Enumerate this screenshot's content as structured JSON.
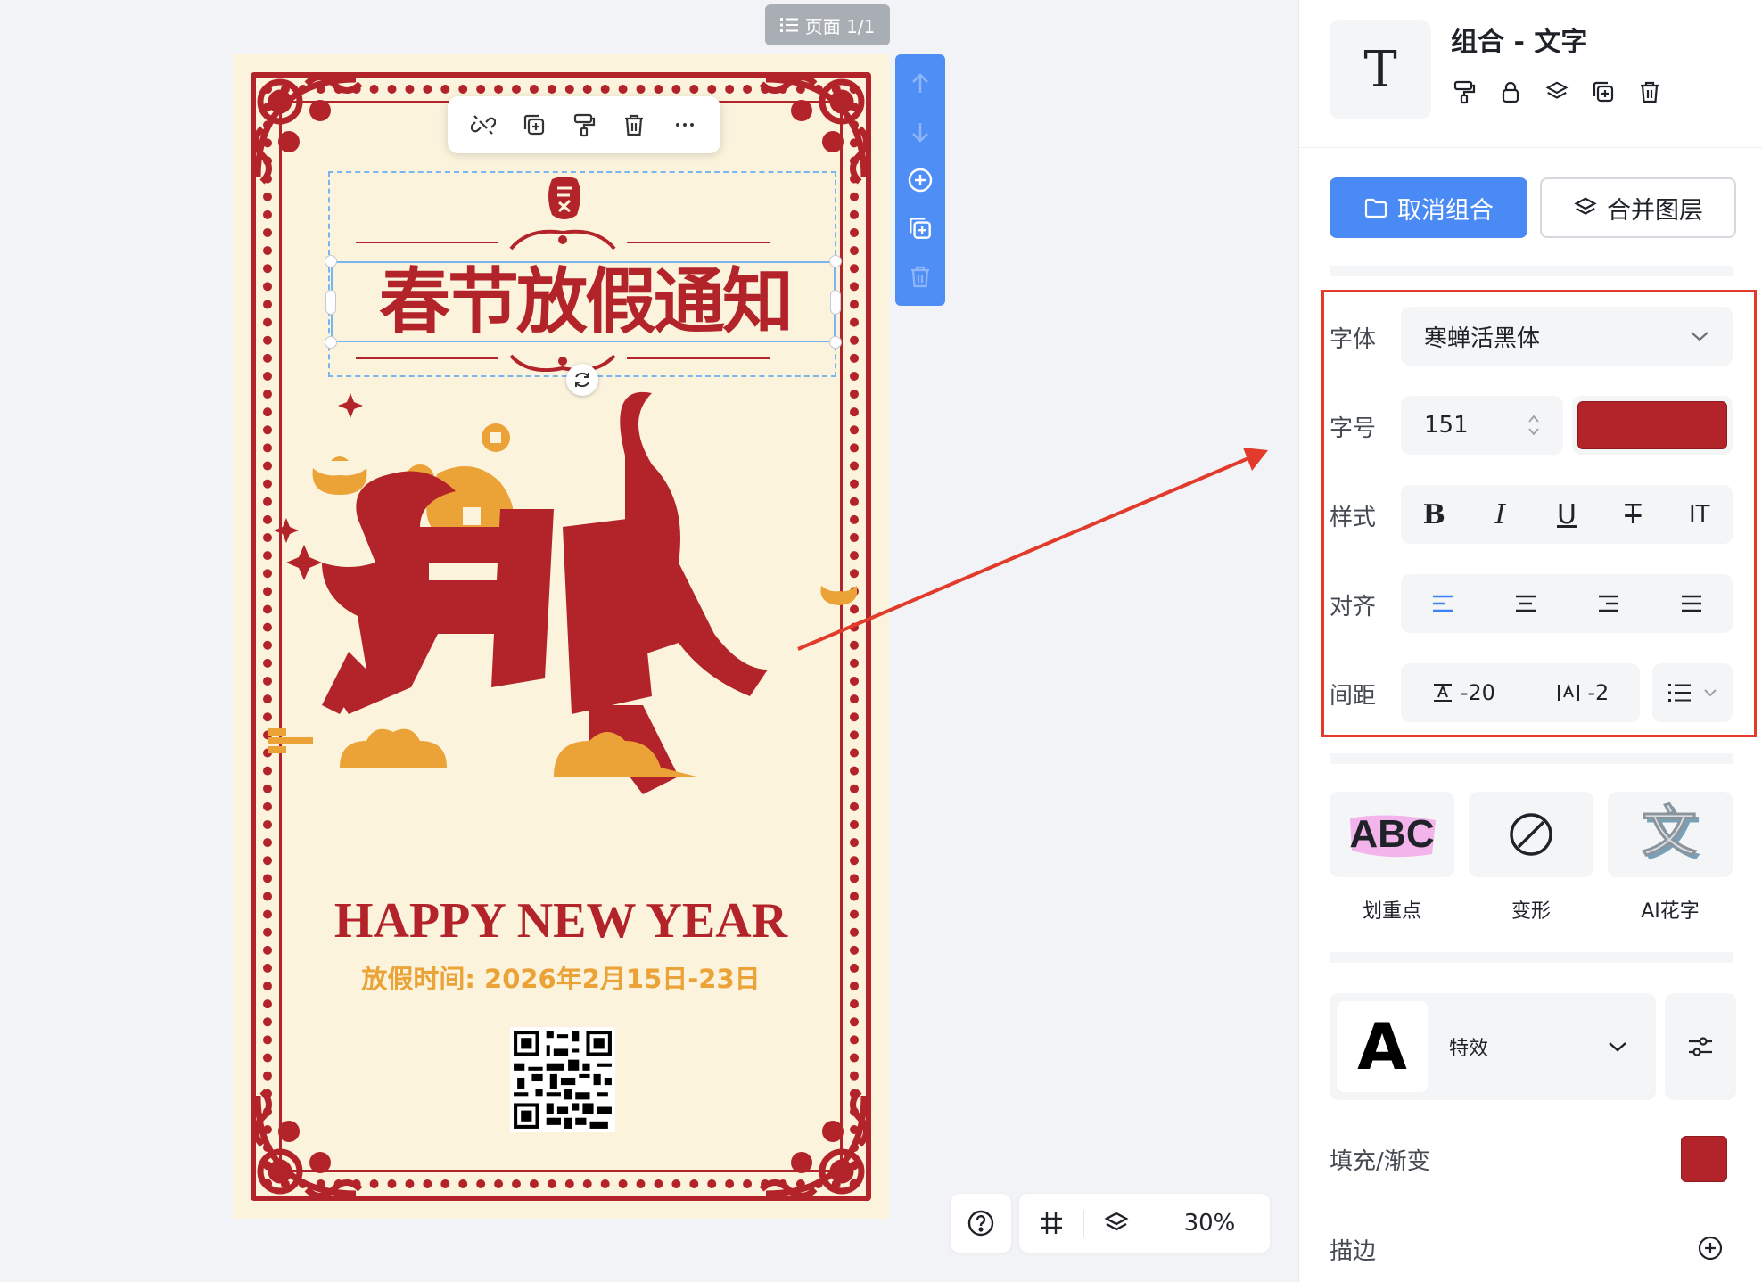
{
  "canvas": {
    "page_indicator": "页面 1/1",
    "zoom": "30%"
  },
  "poster": {
    "title": "春节放假通知",
    "happy_new_year": "HAPPY NEW YEAR",
    "dates": "放假时间: 2026年2月15日-23日",
    "title_color": "#b3232a",
    "background_color": "#fbf3dc",
    "accent_gold": "#eba236"
  },
  "element_toolbar": {
    "icons": [
      "unlink-icon",
      "duplicate-icon",
      "format-painter-icon",
      "trash-icon",
      "more-icon"
    ]
  },
  "side_toolbar": {
    "icons": [
      "arrow-up-icon",
      "arrow-down-icon",
      "add-circle-icon",
      "duplicate-icon",
      "trash-icon"
    ],
    "color": "#4f8ff5"
  },
  "panel": {
    "title": "组合 - 文字",
    "type_glyph": "T",
    "actions": [
      "format-painter-icon",
      "lock-icon",
      "layers-icon",
      "duplicate-icon",
      "trash-icon"
    ],
    "ungroup_label": "取消组合",
    "merge_label": "合并图层",
    "font": {
      "label": "字体",
      "value": "寒蝉活黑体"
    },
    "size": {
      "label": "字号",
      "value": "151"
    },
    "text_color": "#b3232a",
    "style": {
      "label": "样式",
      "buttons": [
        "B",
        "I",
        "U",
        "T",
        "IT"
      ]
    },
    "align": {
      "label": "对齐",
      "selected": "left"
    },
    "spacing": {
      "label": "间距",
      "line_spacing": "-20",
      "letter_spacing": "-2"
    },
    "effects": [
      {
        "label": "划重点",
        "icon": "abc-highlight-icon"
      },
      {
        "label": "变形",
        "icon": "slash-circle-icon"
      },
      {
        "label": "AI花字",
        "icon": "ai-text-icon",
        "glyph": "文"
      }
    ],
    "abc_glyph": "ABC",
    "effects_select": {
      "glyph": "A",
      "label": "特效"
    },
    "fill": {
      "label": "填充/渐变",
      "color": "#b3232a"
    },
    "stroke": {
      "label": "描边"
    }
  }
}
